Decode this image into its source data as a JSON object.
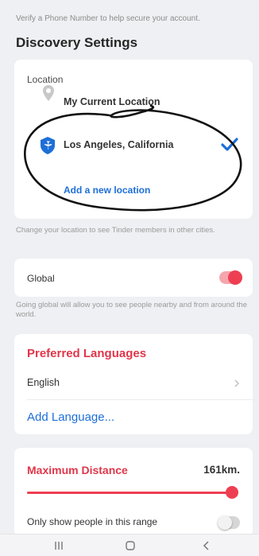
{
  "header": {
    "hint": "Verify a Phone Number to help secure your account.",
    "title": "Discovery Settings"
  },
  "location": {
    "label": "Location",
    "current": "My Current Location",
    "selected": "Los Angeles, California",
    "add": "Add a new location",
    "hint": "Change your location to see Tinder members in other cities."
  },
  "global": {
    "label": "Global",
    "enabled": true,
    "hint": "Going global will allow you to see people nearby and from around the world."
  },
  "languages": {
    "title": "Preferred Languages",
    "value": "English",
    "add": "Add Language..."
  },
  "distance": {
    "title": "Maximum Distance",
    "value": "161km.",
    "only_range_label": "Only show people in this range",
    "only_range_enabled": false
  },
  "icons": {
    "pin": "location-pin-icon",
    "plane": "airplane-icon",
    "check": "checkmark-icon",
    "chevron": "chevron-right-icon"
  },
  "colors": {
    "accent_red": "#ee3f52",
    "link_blue": "#1d6fd8"
  }
}
